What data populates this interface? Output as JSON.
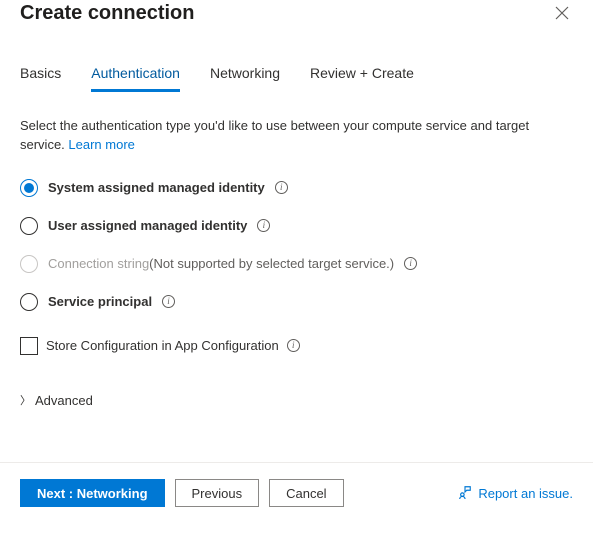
{
  "header": {
    "title": "Create connection"
  },
  "tabs": [
    {
      "label": "Basics"
    },
    {
      "label": "Authentication"
    },
    {
      "label": "Networking"
    },
    {
      "label": "Review + Create"
    }
  ],
  "description": {
    "text": "Select the authentication type you'd like to use between your compute service and target service. ",
    "learn_more": "Learn more"
  },
  "auth_options": [
    {
      "label": "System assigned managed identity",
      "selected": true,
      "disabled": false,
      "aux": ""
    },
    {
      "label": "User assigned managed identity",
      "selected": false,
      "disabled": false,
      "aux": ""
    },
    {
      "label": "Connection string",
      "selected": false,
      "disabled": true,
      "aux": "(Not supported by selected target service.)"
    },
    {
      "label": "Service principal",
      "selected": false,
      "disabled": false,
      "aux": ""
    }
  ],
  "store_config": {
    "label": "Store Configuration in App Configuration"
  },
  "advanced": {
    "label": "Advanced"
  },
  "footer": {
    "next": "Next : Networking",
    "previous": "Previous",
    "cancel": "Cancel",
    "report": "Report an issue."
  }
}
